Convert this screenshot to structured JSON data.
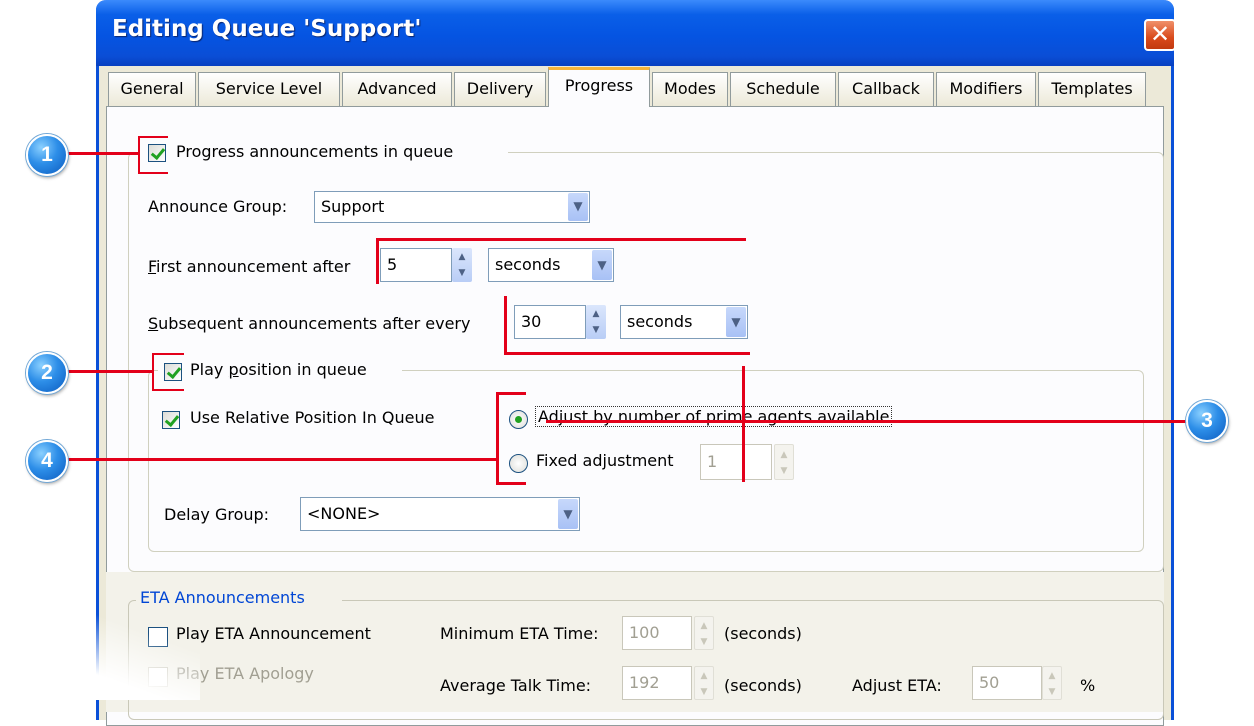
{
  "window": {
    "title": "Editing Queue 'Support'",
    "close_glyph": "✕"
  },
  "tabs": [
    {
      "label": "General"
    },
    {
      "label": "Service Level"
    },
    {
      "label": "Advanced"
    },
    {
      "label": "Delivery"
    },
    {
      "label": "Progress",
      "active": true
    },
    {
      "label": "Modes"
    },
    {
      "label": "Schedule"
    },
    {
      "label": "Callback"
    },
    {
      "label": "Modifiers"
    },
    {
      "label": "Templates"
    }
  ],
  "progress": {
    "enable_label": "Progress announcements in queue",
    "enable_checked": true,
    "announce_group_label": "Announce Group:",
    "announce_group_value": "Support",
    "first_after_prefix": "F",
    "first_after_rest": "irst announcement after",
    "first_after_value": "5",
    "first_after_unit": "seconds",
    "subsequent_prefix": "S",
    "subsequent_rest": "ubsequent announcements after every",
    "subsequent_value": "30",
    "subsequent_unit": "seconds"
  },
  "position": {
    "play_label_a": "Play ",
    "play_label_u": "p",
    "play_label_b": "osition in queue",
    "play_checked": true,
    "relative_label": "Use Relative Position In Queue",
    "relative_checked": true,
    "adjust_prime_label": "Adjust by number of prime agents available",
    "fixed_label": "Fixed adjustment",
    "fixed_value": "1",
    "delay_group_label": "Delay Group:",
    "delay_group_value": "<NONE>"
  },
  "eta": {
    "section_label": "ETA Announcements",
    "play_eta_label": "Play ETA Announcement",
    "play_apology_label": "Play ETA Apology",
    "min_eta_label": "Minimum ETA Time:",
    "min_eta_value": "100",
    "min_eta_unit": "(seconds)",
    "avg_talk_label": "Average Talk Time:",
    "avg_talk_value": "192",
    "avg_talk_unit": "(seconds)",
    "adjust_eta_label": "Adjust ETA:",
    "adjust_eta_value": "50",
    "adjust_eta_unit": "%"
  },
  "callouts": [
    "1",
    "2",
    "3",
    "4"
  ],
  "colors": {
    "titlebar": "#0554e2",
    "callout_line": "#e3001a",
    "callout_badge": "#2d8ee8",
    "active_tab_accent": "#f7b43a",
    "checkmark": "#21a121",
    "section_title": "#0046d5"
  }
}
